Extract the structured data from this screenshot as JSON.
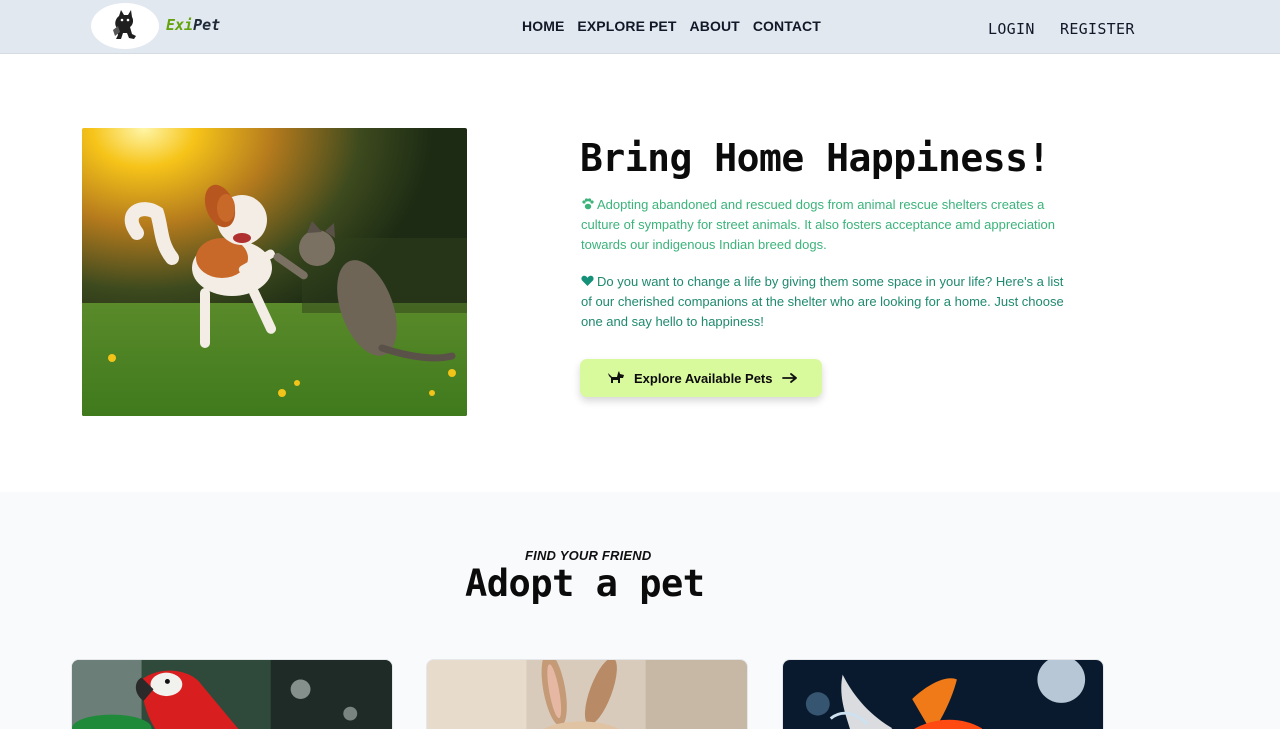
{
  "brand": {
    "part1": "Exi",
    "part2": "Pet",
    "logo_icon": "cat-dog-logo-icon"
  },
  "nav": {
    "links": [
      "HOME",
      "EXPLORE PET",
      "ABOUT",
      "CONTACT"
    ],
    "login": "LOGIN",
    "register": "REGISTER"
  },
  "hero": {
    "image_alt_icon": "puppy-kitten-photo",
    "title": "Bring Home Happiness!",
    "paragraph1": "Adopting abandoned and rescued dogs from animal rescue shelters creates a culture of sympathy for street animals. It also fosters acceptance amd appreciation towards our indigenous Indian breed dogs.",
    "paragraph2": "Do you want to change a life by giving them some space in your life? Here's a list of our cherished companions at the shelter who are looking for a home. Just choose one and say hello to happiness!",
    "cta": "Explore Available Pets",
    "icons": {
      "p1": "paw-icon",
      "p2": "heart-icon",
      "cta_left": "dog-icon",
      "cta_right": "arrow-right-icon"
    },
    "colors": {
      "p1": "#3bb37a",
      "p2": "#1f8a6e",
      "cta_bg": "#d9f99d"
    }
  },
  "adopt": {
    "eyebrow": "FIND YOUR FRIEND",
    "title": "Adopt a pet",
    "cards": [
      {
        "icon": "parrot-photo"
      },
      {
        "icon": "rabbit-photo"
      },
      {
        "icon": "goldfish-photo"
      }
    ]
  },
  "colors": {
    "navbar_bg": "#e2e8f0",
    "brand_accent": "#65a30d",
    "section_bg": "#f8fafc"
  }
}
